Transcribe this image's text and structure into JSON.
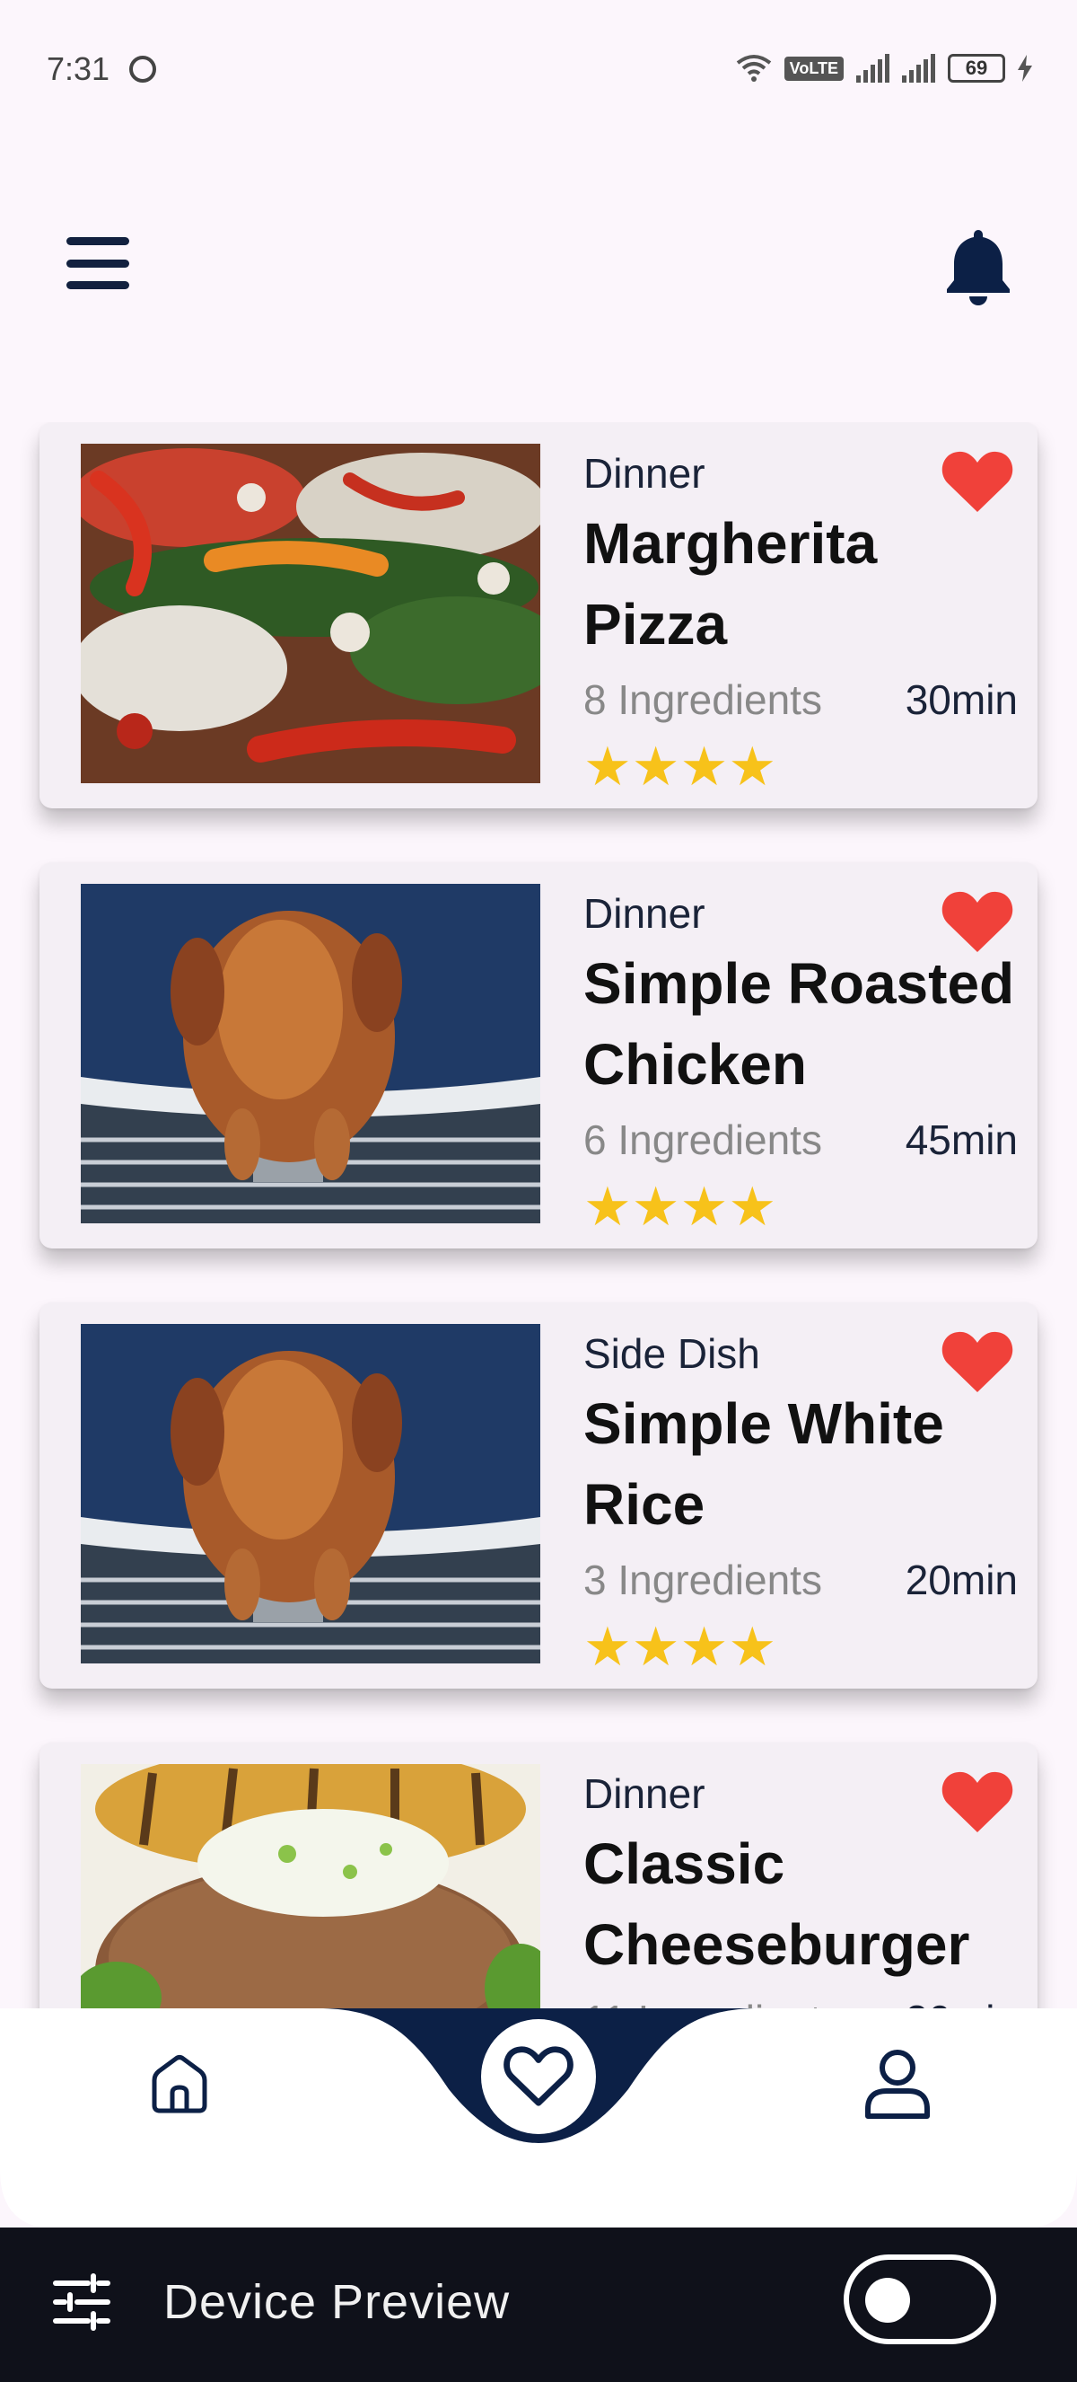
{
  "status_bar": {
    "time": "7:31",
    "battery": "69",
    "network": "VoLTE"
  },
  "header": {
    "menu_icon": "hamburger-menu-icon",
    "notification_icon": "bell-icon"
  },
  "recipes": [
    {
      "category": "Dinner",
      "title": "Margherita Pizza",
      "ingredients": "8 Ingredients",
      "time": "30min",
      "stars": "★★★★",
      "favorite": true
    },
    {
      "category": "Dinner",
      "title": "Simple Roasted Chicken",
      "ingredients": "6 Ingredients",
      "time": "45min",
      "stars": "★★★★",
      "favorite": true
    },
    {
      "category": "Side Dish",
      "title": "Simple White Rice",
      "ingredients": "3 Ingredients",
      "time": "20min",
      "stars": "★★★★",
      "favorite": true
    },
    {
      "category": "Dinner",
      "title": "Classic Cheeseburger",
      "ingredients": "11 Ingredients",
      "time": "30min",
      "stars": "★★★★",
      "favorite": true
    }
  ],
  "bottom_nav": {
    "items": [
      "home-icon",
      "favorites-icon",
      "profile-icon"
    ],
    "active": "favorites"
  },
  "device_preview": {
    "label": "Device Preview",
    "toggle_on": false
  },
  "colors": {
    "navy": "#0c2046",
    "heart": "#f0413a",
    "star": "#f7c21a",
    "background": "#fcf6fc"
  }
}
